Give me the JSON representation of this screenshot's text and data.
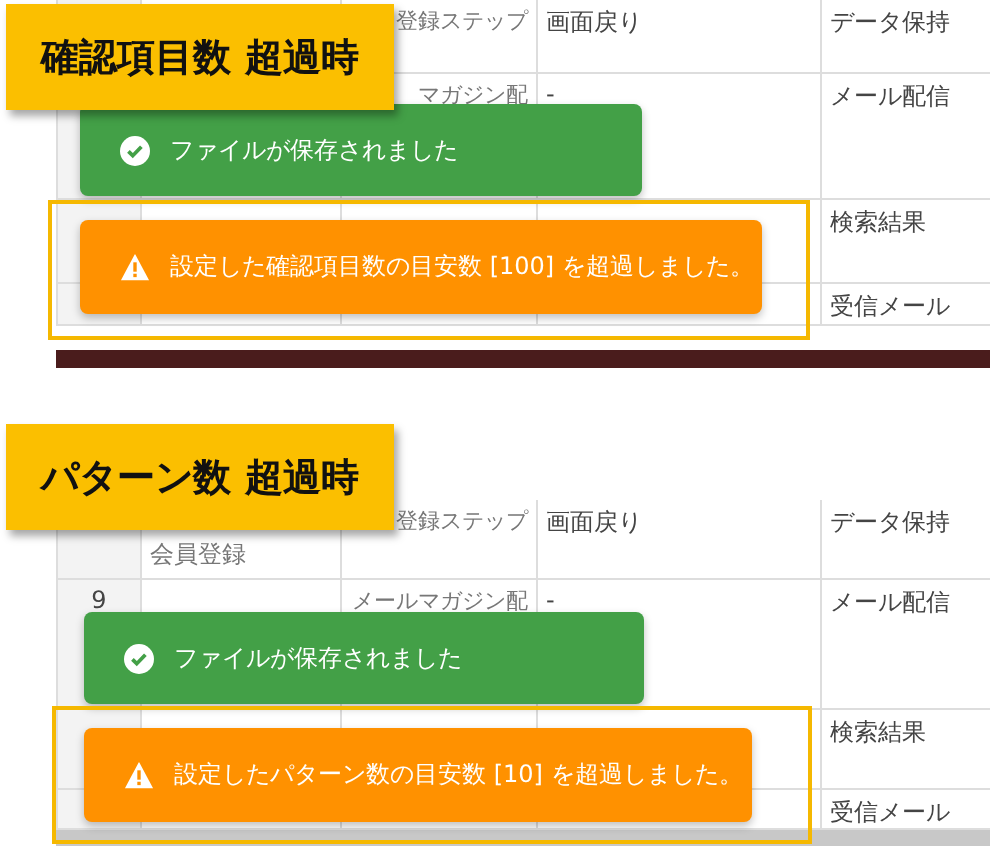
{
  "panels": [
    {
      "title": "確認項目数 超過時",
      "bottom": {
        "kind": "dark"
      },
      "rows": [
        {
          "column_3": "登録ステップ",
          "column_4": "画面戻り",
          "column_5": "データ保持"
        },
        {
          "column_3": "マガジン配",
          "column_4": "-",
          "column_5": "メール配信"
        },
        {
          "column_5": "検索結果"
        },
        {
          "column_5": "受信メール"
        }
      ],
      "toasts": [
        {
          "kind": "success",
          "text": "ファイルが保存されました"
        },
        {
          "kind": "warning",
          "text": "設定した確認項目数の目安数 [100] を超過しました。",
          "highlighted": true
        }
      ]
    },
    {
      "title": "パターン数 超過時",
      "bottom": {
        "kind": "scrollbar"
      },
      "rows": [
        {
          "column_2": "会員登録",
          "column_3": "登録ステップ",
          "column_4": "画面戻り",
          "column_5": "データ保持"
        },
        {
          "column_1": "9",
          "column_3": "メールマガジン配",
          "column_4": "-",
          "column_5": "メール配信"
        },
        {
          "column_5": "検索結果"
        },
        {
          "column_5": "受信メール"
        }
      ],
      "toasts": [
        {
          "kind": "success",
          "text": "ファイルが保存されました"
        },
        {
          "kind": "warning",
          "text": "設定したパターン数の目安数 [10] を超過しました。",
          "highlighted": true
        }
      ]
    }
  ]
}
